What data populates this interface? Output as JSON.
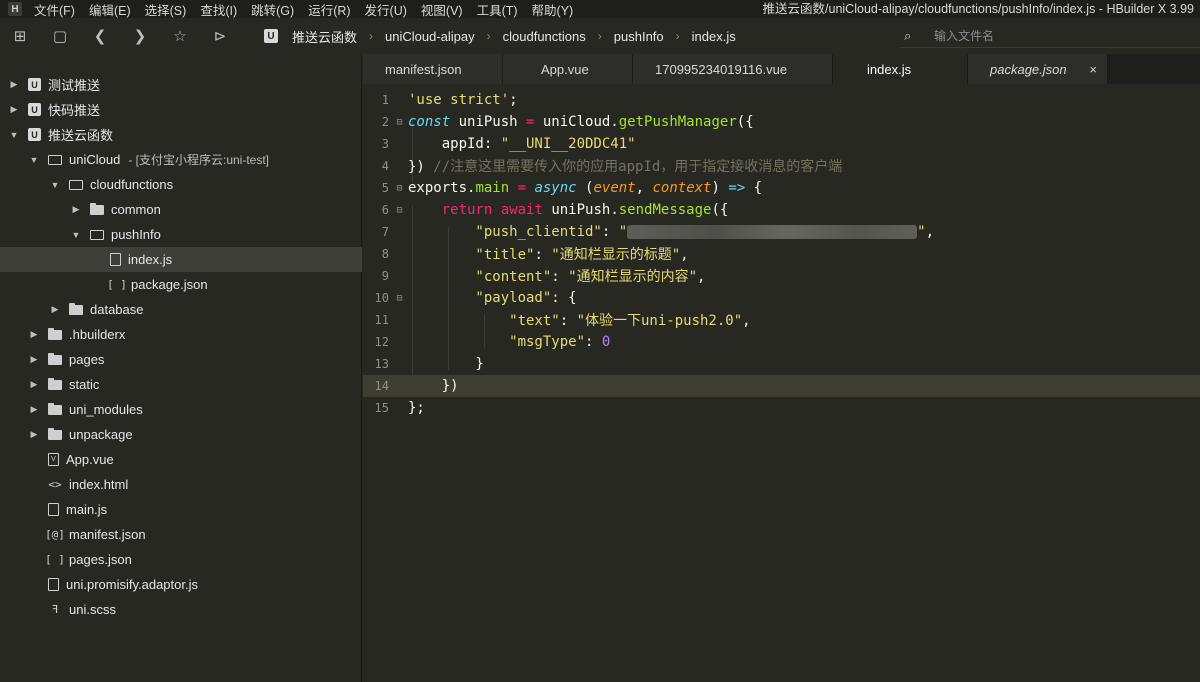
{
  "menubar": {
    "logo": "H",
    "items": [
      "文件(F)",
      "编辑(E)",
      "选择(S)",
      "查找(I)",
      "跳转(G)",
      "运行(R)",
      "发行(U)",
      "视图(V)",
      "工具(T)",
      "帮助(Y)"
    ],
    "window_title": "推送云函数/uniCloud-alipay/cloudfunctions/pushInfo/index.js - HBuilder X 3.99"
  },
  "breadcrumb": {
    "logo": "U",
    "items": [
      "推送云函数",
      "uniCloud-alipay",
      "cloudfunctions",
      "pushInfo",
      "index.js"
    ]
  },
  "search": {
    "placeholder": "输入文件名"
  },
  "tree": [
    {
      "label": "测试推送",
      "note": ""
    },
    {
      "label": "快码推送",
      "note": ""
    },
    {
      "label": "推送云函数",
      "note": ""
    },
    {
      "label": "uniCloud",
      "note": "- [支付宝小程序云:uni-test]"
    },
    {
      "label": "cloudfunctions",
      "note": ""
    },
    {
      "label": "common",
      "note": ""
    },
    {
      "label": "pushInfo",
      "note": ""
    },
    {
      "label": "index.js",
      "note": ""
    },
    {
      "label": "package.json",
      "note": ""
    },
    {
      "label": "database",
      "note": ""
    },
    {
      "label": ".hbuilderx",
      "note": ""
    },
    {
      "label": "pages",
      "note": ""
    },
    {
      "label": "static",
      "note": ""
    },
    {
      "label": "uni_modules",
      "note": ""
    },
    {
      "label": "unpackage",
      "note": ""
    },
    {
      "label": "App.vue",
      "note": ""
    },
    {
      "label": "index.html",
      "note": ""
    },
    {
      "label": "main.js",
      "note": ""
    },
    {
      "label": "manifest.json",
      "note": ""
    },
    {
      "label": "pages.json",
      "note": ""
    },
    {
      "label": "uni.promisify.adaptor.js",
      "note": ""
    },
    {
      "label": "uni.scss",
      "note": ""
    }
  ],
  "tree_icons": {
    "project": "U",
    "vue": "V",
    "html": "<>",
    "json": "[ ]",
    "manifest": "[@]",
    "scss": "ꟻ"
  },
  "tabs": [
    {
      "label": "manifest.json"
    },
    {
      "label": "App.vue"
    },
    {
      "label": "170995234019116.vue"
    },
    {
      "label": "index.js"
    },
    {
      "label": "package.json"
    }
  ],
  "tab_close": "×",
  "editor": {
    "line_numbers": [
      "1",
      "2",
      "3",
      "4",
      "5",
      "6",
      "7",
      "8",
      "9",
      "10",
      "11",
      "12",
      "13",
      "14",
      "15"
    ],
    "tokens": {
      "l1_str": "'use strict'",
      "l1_semi": ";",
      "l2_const": "const",
      "l2_var": " uniPush ",
      "l2_eq": "=",
      "l2_obj": " uniCloud.",
      "l2_fn": "getPushManager",
      "l2_open": "({",
      "l3_key": "    appId: ",
      "l3_val": "\"__UNI__20DDC41\"",
      "l4_close": "}) ",
      "l4_comment": "//注意这里需要传入你的应用appId，用于指定接收消息的客户端",
      "l5_exports": "exports.",
      "l5_main": "main",
      "l5_eq": " = ",
      "l5_async": "async",
      "l5_po": " (",
      "l5_p1": "event",
      "l5_comma": ", ",
      "l5_p2": "context",
      "l5_pc": ") ",
      "l5_arrow": "=>",
      "l5_brace": " {",
      "l6_return": "    return",
      "l6_sp": " ",
      "l6_await": "await",
      "l6_obj": " uniPush.",
      "l6_fn": "sendMessage",
      "l6_open": "({",
      "l7_key": "        \"push_clientid\"",
      "l7_colon": ": ",
      "l7_q1": "\"",
      "l7_q2": "\"",
      "l7_comma": ",",
      "l8_key": "        \"title\"",
      "l8_colon": ": ",
      "l8_val": "\"通知栏显示的标题\"",
      "l8_comma": ",",
      "l9_key": "        \"content\"",
      "l9_colon": ": ",
      "l9_val": "\"通知栏显示的内容\"",
      "l9_comma": ",",
      "l10_key": "        \"payload\"",
      "l10_rest": ": {",
      "l11_key": "            \"text\"",
      "l11_colon": ": ",
      "l11_val": "\"体验一下uni-push2.0\"",
      "l11_comma": ",",
      "l12_key": "            \"msgType\"",
      "l12_colon": ": ",
      "l12_val": "0",
      "l13": "        }",
      "l14": "    })",
      "l15": "};"
    }
  },
  "colors": {
    "background": "#272822",
    "keyword": "#f92672",
    "string": "#e6db74",
    "function": "#a6e22e",
    "comment": "#75715e",
    "number": "#ae81ff"
  }
}
